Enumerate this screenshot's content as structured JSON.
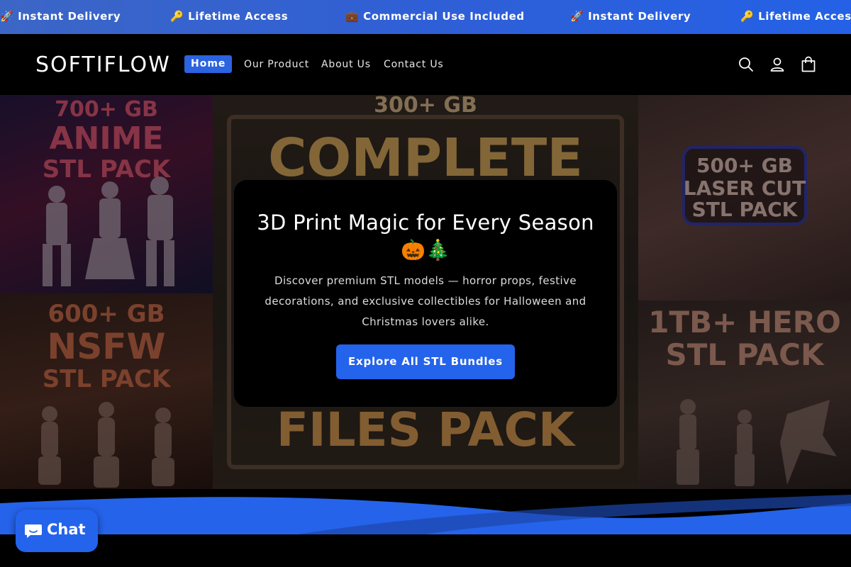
{
  "announcement": {
    "items": [
      {
        "label": "🚀 Instant Delivery"
      },
      {
        "label": "🔑 Lifetime Access"
      },
      {
        "label": "💼 Commercial Use Included"
      },
      {
        "label": "🚀 Instant Delivery"
      },
      {
        "label": "🔑 Lifetime Access"
      }
    ]
  },
  "header": {
    "logo": "SOFTIFLOW",
    "nav": [
      {
        "label": "Home",
        "active": true
      },
      {
        "label": "Our Product"
      },
      {
        "label": "About Us"
      },
      {
        "label": "Contact Us"
      }
    ],
    "icons": [
      "search-icon",
      "account-icon",
      "cart-icon"
    ]
  },
  "hero": {
    "panels": [
      {
        "line1": "700+ GB",
        "line2": "ANIME",
        "line3": "STL PACK"
      },
      {
        "line1": "300+ GB",
        "line2": "COMPLETE",
        "line3": "FILES PACK"
      },
      {
        "line1": "500+ GB",
        "line2": "LASER CUT",
        "line3": "STL PACK"
      },
      {
        "line1": "600+ GB",
        "line2": "NSFW",
        "line3": "STL PACK"
      },
      {
        "line1": "1TB+ HERO",
        "line2": "STL PACK",
        "line3": ""
      }
    ],
    "title": "3D Print Magic for Every Season",
    "emoji": "🎃🎄",
    "description": "Discover premium STL models — horror props, festive decorations, and exclusive collectibles for Halloween and Christmas lovers alike.",
    "cta": "Explore All STL Bundles"
  },
  "chat": {
    "label": "Chat"
  },
  "colors": {
    "accent": "#2463eb",
    "background": "#000000",
    "marquee": "#2f5fd6"
  }
}
